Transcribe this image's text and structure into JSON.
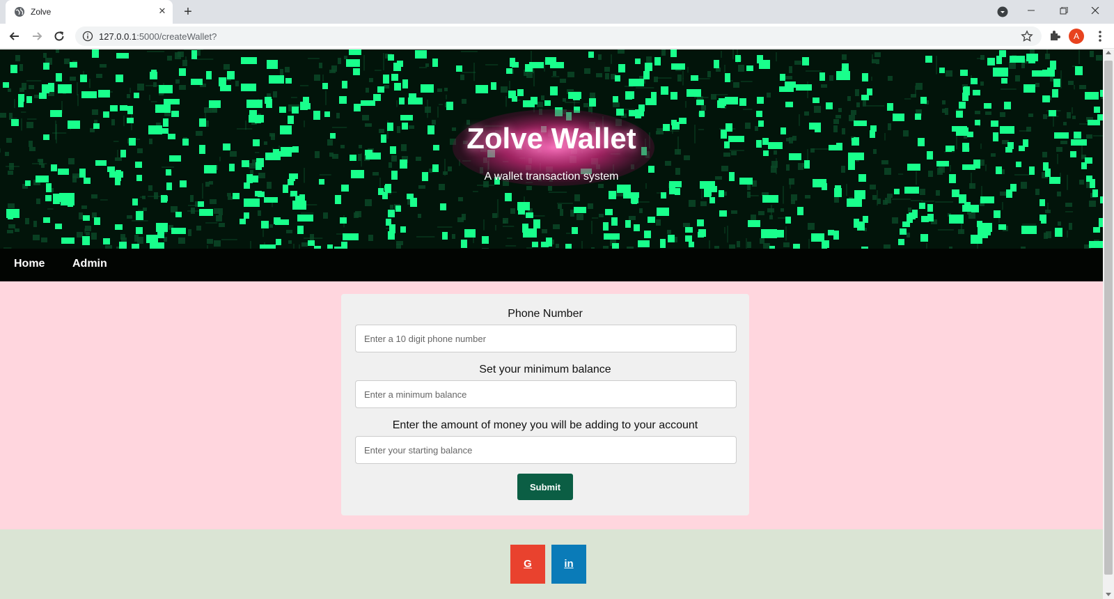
{
  "browser": {
    "tab_title": "Zolve",
    "url_host": "127.0.0.1",
    "url_path": ":5000/createWallet?",
    "profile_initial": "A"
  },
  "hero": {
    "title": "Zolve Wallet",
    "subtitle": "A wallet transaction system"
  },
  "nav": {
    "items": [
      {
        "label": "Home"
      },
      {
        "label": "Admin"
      }
    ]
  },
  "form": {
    "fields": [
      {
        "label": "Phone Number",
        "placeholder": "Enter a 10 digit phone number",
        "value": ""
      },
      {
        "label": "Set your minimum balance",
        "placeholder": "Enter a minimum balance",
        "value": ""
      },
      {
        "label": "Enter the amount of money you will be adding to your account",
        "placeholder": "Enter your starting balance",
        "value": ""
      }
    ],
    "submit_label": "Submit"
  },
  "footer": {
    "social": [
      {
        "label": "G",
        "icon": "google-icon",
        "color": "#e9422e"
      },
      {
        "label": "in",
        "icon": "linkedin-icon",
        "color": "#0a7bb8"
      }
    ]
  },
  "colors": {
    "hero_bg": "#02140a",
    "hero_glyph": "#19ff8c",
    "nav_bg": "#020502",
    "main_bg": "#ffd6de",
    "footer_bg": "#dae4d4",
    "submit_bg": "#0b5e44"
  }
}
